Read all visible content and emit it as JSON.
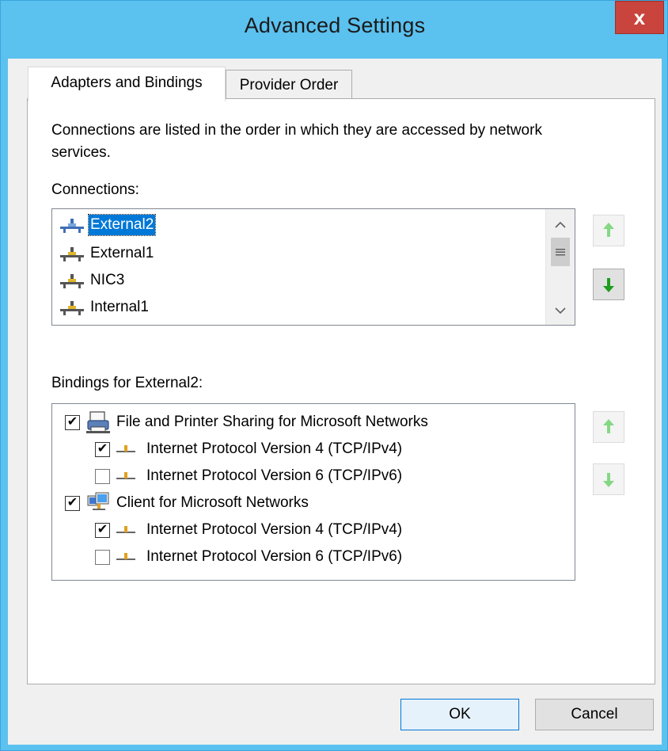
{
  "window": {
    "title": "Advanced Settings",
    "close_label": "x"
  },
  "tabs": [
    {
      "label": "Adapters and Bindings",
      "active": true
    },
    {
      "label": "Provider Order",
      "active": false
    }
  ],
  "description": "Connections are listed in the order in which they are accessed by network services.",
  "connections": {
    "label": "Connections:",
    "items": [
      {
        "label": "External2",
        "selected": true
      },
      {
        "label": "External1",
        "selected": false
      },
      {
        "label": "NIC3",
        "selected": false
      },
      {
        "label": "Internal1",
        "selected": false
      }
    ],
    "move_up_enabled": false,
    "move_down_enabled": true
  },
  "bindings": {
    "label": "Bindings for External2:",
    "rows": [
      {
        "level": 0,
        "checked": true,
        "icon": "printer-share-icon",
        "label": "File and Printer Sharing for Microsoft Networks"
      },
      {
        "level": 1,
        "checked": true,
        "icon": "protocol-icon",
        "label": "Internet Protocol Version 4 (TCP/IPv4)"
      },
      {
        "level": 1,
        "checked": false,
        "icon": "protocol-icon",
        "label": "Internet Protocol Version 6 (TCP/IPv6)"
      },
      {
        "level": 0,
        "checked": true,
        "icon": "client-network-icon",
        "label": "Client for Microsoft Networks"
      },
      {
        "level": 1,
        "checked": true,
        "icon": "protocol-icon",
        "label": "Internet Protocol Version 4 (TCP/IPv4)"
      },
      {
        "level": 1,
        "checked": false,
        "icon": "protocol-icon",
        "label": "Internet Protocol Version 6 (TCP/IPv6)"
      }
    ],
    "move_up_enabled": false,
    "move_down_enabled": false
  },
  "buttons": {
    "ok": "OK",
    "cancel": "Cancel"
  },
  "colors": {
    "titlebar": "#5bc1ef",
    "close": "#c8443c",
    "selection": "#0078d7",
    "arrow_green": "#1e9e1e"
  }
}
